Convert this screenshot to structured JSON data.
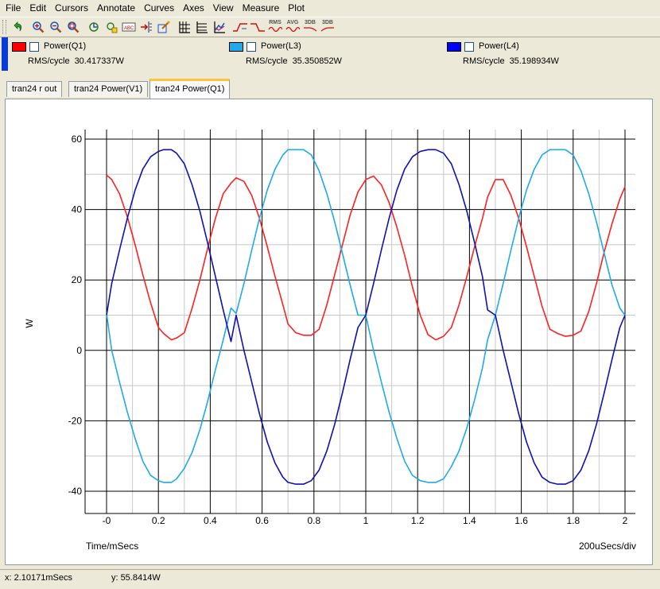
{
  "menu": [
    "File",
    "Edit",
    "Cursors",
    "Annotate",
    "Curves",
    "Axes",
    "View",
    "Measure",
    "Plot"
  ],
  "toolbar": {
    "buttons": [
      "undo-icon",
      "zoom-in-icon",
      "zoom-in-box-icon",
      "zoom-out-icon",
      "cursor-icon",
      "cursor-step-icon",
      "label-icon",
      "tag-icon",
      "auto-label-icon",
      "grid-icon",
      "grid-minor-icon",
      "chart-icon",
      "rise-time-icon",
      "fall-time-icon",
      "rms-icon",
      "avg-icon",
      "3db-low-icon",
      "3db-high-icon"
    ],
    "rms_label": "RMS",
    "avg_label": "AVG",
    "db_low_label": "3DB",
    "db_high_label": "3DB"
  },
  "legend": [
    {
      "name": "Power(Q1)",
      "measure_label": "RMS/cycle",
      "measure_value": "30.417337W",
      "color": "#ff0000"
    },
    {
      "name": "Power(L3)",
      "measure_label": "RMS/cycle",
      "measure_value": "35.350852W",
      "color": "#1eaaeb"
    },
    {
      "name": "Power(L4)",
      "measure_label": "RMS/cycle",
      "measure_value": "35.198934W",
      "color": "#0000ff"
    }
  ],
  "tabs": [
    {
      "label": "tran24 r out",
      "active": false
    },
    {
      "label": "tran24 Power(V1)",
      "active": false
    },
    {
      "label": "tran24 Power(Q1)",
      "active": true
    }
  ],
  "chart_data": {
    "type": "line",
    "xlabel": "Time/mSecs",
    "ylabel": "W",
    "x_div_label": "200uSecs/div",
    "xlim": [
      -0.02,
      2.02
    ],
    "ylim": [
      -44,
      60
    ],
    "x_ticks": [
      "-0",
      "0.2",
      "0.4",
      "0.6",
      "0.8",
      "1",
      "1.2",
      "1.4",
      "1.6",
      "1.8",
      "2"
    ],
    "x_tick_values": [
      0,
      0.2,
      0.4,
      0.6,
      0.8,
      1.0,
      1.2,
      1.4,
      1.6,
      1.8,
      2.0
    ],
    "y_ticks": [
      "60",
      "40",
      "20",
      "0",
      "-20",
      "-40"
    ],
    "y_tick_values": [
      60,
      40,
      20,
      0,
      -20,
      -40
    ],
    "grid": true,
    "series": [
      {
        "name": "Power(Q1)",
        "color": "#ff2020",
        "x": [
          0.0,
          0.02,
          0.05,
          0.08,
          0.11,
          0.14,
          0.17,
          0.2,
          0.22,
          0.25,
          0.27,
          0.3,
          0.33,
          0.36,
          0.39,
          0.42,
          0.45,
          0.48,
          0.5,
          0.53,
          0.56,
          0.59,
          0.62,
          0.65,
          0.68,
          0.7,
          0.73,
          0.76,
          0.79,
          0.82,
          0.85,
          0.88,
          0.91,
          0.94,
          0.97,
          1.0,
          1.03,
          1.06,
          1.09,
          1.12,
          1.15,
          1.18,
          1.21,
          1.24,
          1.27,
          1.3,
          1.33,
          1.36,
          1.39,
          1.42,
          1.45,
          1.47,
          1.5,
          1.53,
          1.56,
          1.59,
          1.62,
          1.65,
          1.68,
          1.71,
          1.74,
          1.77,
          1.8,
          1.83,
          1.86,
          1.89,
          1.92,
          1.95,
          1.98,
          2.0
        ],
        "y": [
          49.8,
          48.5,
          44.5,
          38.0,
          30.0,
          21.5,
          13.5,
          6.5,
          4.8,
          3.0,
          3.5,
          5.0,
          12.0,
          20.0,
          29.0,
          37.5,
          44.5,
          47.5,
          49.0,
          48.0,
          44.0,
          37.5,
          29.5,
          21.0,
          13.0,
          7.5,
          5.0,
          4.3,
          4.3,
          6.0,
          13.0,
          21.5,
          30.0,
          38.5,
          45.0,
          48.5,
          49.5,
          47.0,
          42.0,
          35.0,
          27.0,
          18.0,
          10.0,
          4.5,
          3.0,
          4.0,
          6.5,
          13.0,
          21.0,
          29.5,
          37.5,
          43.5,
          48.5,
          48.5,
          44.0,
          37.5,
          29.5,
          21.0,
          12.5,
          6.0,
          4.8,
          4.0,
          4.3,
          5.5,
          11.0,
          19.0,
          28.0,
          36.0,
          43.0,
          46.5
        ]
      },
      {
        "name": "Power(L3)",
        "color": "#1eaaeb",
        "x": [
          0.0,
          0.02,
          0.05,
          0.08,
          0.11,
          0.14,
          0.17,
          0.2,
          0.22,
          0.25,
          0.27,
          0.3,
          0.33,
          0.36,
          0.39,
          0.42,
          0.45,
          0.48,
          0.5,
          0.53,
          0.56,
          0.59,
          0.62,
          0.65,
          0.68,
          0.7,
          0.73,
          0.76,
          0.79,
          0.82,
          0.85,
          0.88,
          0.91,
          0.94,
          0.97,
          1.0,
          1.03,
          1.06,
          1.09,
          1.12,
          1.15,
          1.18,
          1.21,
          1.24,
          1.27,
          1.3,
          1.33,
          1.36,
          1.39,
          1.42,
          1.45,
          1.47,
          1.5,
          1.53,
          1.56,
          1.59,
          1.62,
          1.65,
          1.68,
          1.71,
          1.74,
          1.77,
          1.8,
          1.83,
          1.86,
          1.89,
          1.92,
          1.95,
          1.98,
          2.0
        ],
        "y": [
          10.5,
          0.0,
          -9.0,
          -17.5,
          -25.0,
          -31.5,
          -35.5,
          -37.0,
          -37.5,
          -37.5,
          -36.5,
          -33.5,
          -29.0,
          -22.5,
          -14.5,
          -5.5,
          3.0,
          12.0,
          10.5,
          19.0,
          28.5,
          37.5,
          45.5,
          51.5,
          55.5,
          57.0,
          57.0,
          57.0,
          55.5,
          51.0,
          44.5,
          36.5,
          27.5,
          18.5,
          10.0,
          10.0,
          0.0,
          -9.0,
          -17.5,
          -25.0,
          -31.5,
          -35.5,
          -37.0,
          -37.5,
          -37.5,
          -36.5,
          -33.0,
          -28.5,
          -22.0,
          -14.0,
          -5.0,
          3.0,
          10.0,
          19.0,
          28.5,
          37.5,
          45.5,
          51.5,
          55.5,
          57.0,
          57.0,
          57.0,
          55.5,
          51.0,
          44.5,
          36.5,
          27.5,
          18.5,
          12.0,
          10.0
        ]
      },
      {
        "name": "Power(L4)",
        "color": "#1010b0",
        "x": [
          0.0,
          0.02,
          0.05,
          0.08,
          0.11,
          0.14,
          0.17,
          0.2,
          0.22,
          0.25,
          0.27,
          0.3,
          0.33,
          0.36,
          0.39,
          0.42,
          0.45,
          0.48,
          0.5,
          0.53,
          0.56,
          0.59,
          0.62,
          0.65,
          0.68,
          0.7,
          0.73,
          0.76,
          0.79,
          0.82,
          0.85,
          0.88,
          0.91,
          0.94,
          0.97,
          1.0,
          1.03,
          1.06,
          1.09,
          1.12,
          1.15,
          1.18,
          1.21,
          1.24,
          1.27,
          1.3,
          1.33,
          1.36,
          1.39,
          1.42,
          1.45,
          1.47,
          1.5,
          1.53,
          1.56,
          1.59,
          1.62,
          1.65,
          1.68,
          1.71,
          1.74,
          1.77,
          1.8,
          1.83,
          1.86,
          1.89,
          1.92,
          1.95,
          1.98,
          2.0
        ],
        "y": [
          10.0,
          19.0,
          28.5,
          37.5,
          45.5,
          51.5,
          55.0,
          56.5,
          57.0,
          57.0,
          56.0,
          53.0,
          47.0,
          39.5,
          30.5,
          21.0,
          11.5,
          2.5,
          10.0,
          0.0,
          -9.0,
          -18.0,
          -26.0,
          -32.0,
          -36.0,
          -37.5,
          -38.0,
          -38.0,
          -37.0,
          -34.0,
          -28.5,
          -21.0,
          -12.0,
          -2.5,
          6.5,
          10.0,
          19.0,
          28.5,
          37.5,
          45.5,
          51.5,
          55.0,
          56.5,
          57.0,
          57.0,
          56.0,
          53.0,
          47.0,
          39.5,
          30.5,
          21.0,
          11.5,
          10.0,
          0.0,
          -9.0,
          -18.0,
          -26.0,
          -32.0,
          -36.0,
          -37.5,
          -38.0,
          -38.0,
          -37.0,
          -34.0,
          -28.5,
          -21.0,
          -12.0,
          -2.5,
          6.5,
          10.0
        ]
      }
    ]
  },
  "status": {
    "x_label": "x:",
    "x_value": "2.10171mSecs",
    "y_label": "y:",
    "y_value": "55.8414W"
  }
}
